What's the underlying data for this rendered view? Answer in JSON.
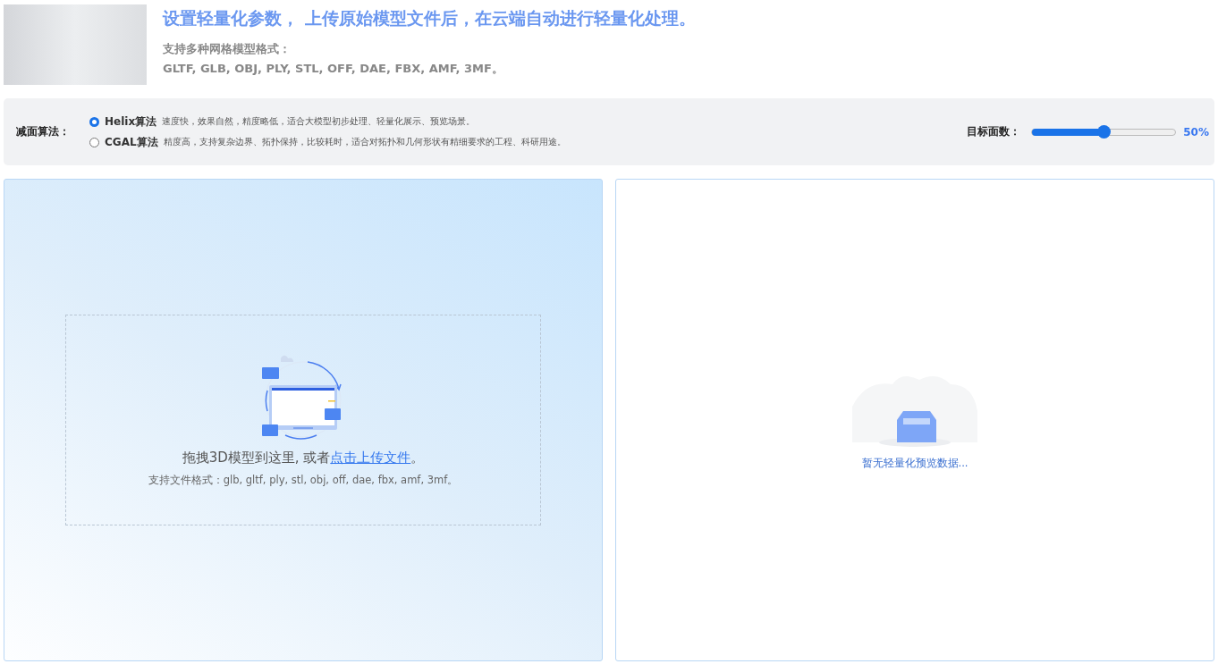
{
  "header": {
    "title": "设置轻量化参数， 上传原始模型文件后，在云端自动进行轻量化处理。",
    "formats_label": "支持多种网格模型格式：",
    "formats": "GLTF, GLB, OBJ, PLY, STL, OFF, DAE, FBX, AMF, 3MF。"
  },
  "settings": {
    "algorithm_label": "减面算法：",
    "algorithms": [
      {
        "name": "Helix算法",
        "description": "速度快，效果自然，精度略低，适合大模型初步处理、轻量化展示、预览场景。",
        "selected": true
      },
      {
        "name": "CGAL算法",
        "description": "精度高，支持复杂边界、拓扑保持，比较耗时，适合对拓扑和几何形状有精细要求的工程、科研用途。",
        "selected": false
      }
    ],
    "target_label": "目标面数：",
    "target": {
      "level": 0.5
    },
    "target_reading": "50%"
  },
  "upload": {
    "text_before": "拖拽3D模型到这里, 或者",
    "link": "点击上传文件",
    "text_after": "。",
    "formats": "支持文件格式：glb, gltf, ply, stl, obj, off, dae, fbx, amf, 3mf。"
  },
  "preview": {
    "empty_text": "暂无轻量化预览数据..."
  }
}
